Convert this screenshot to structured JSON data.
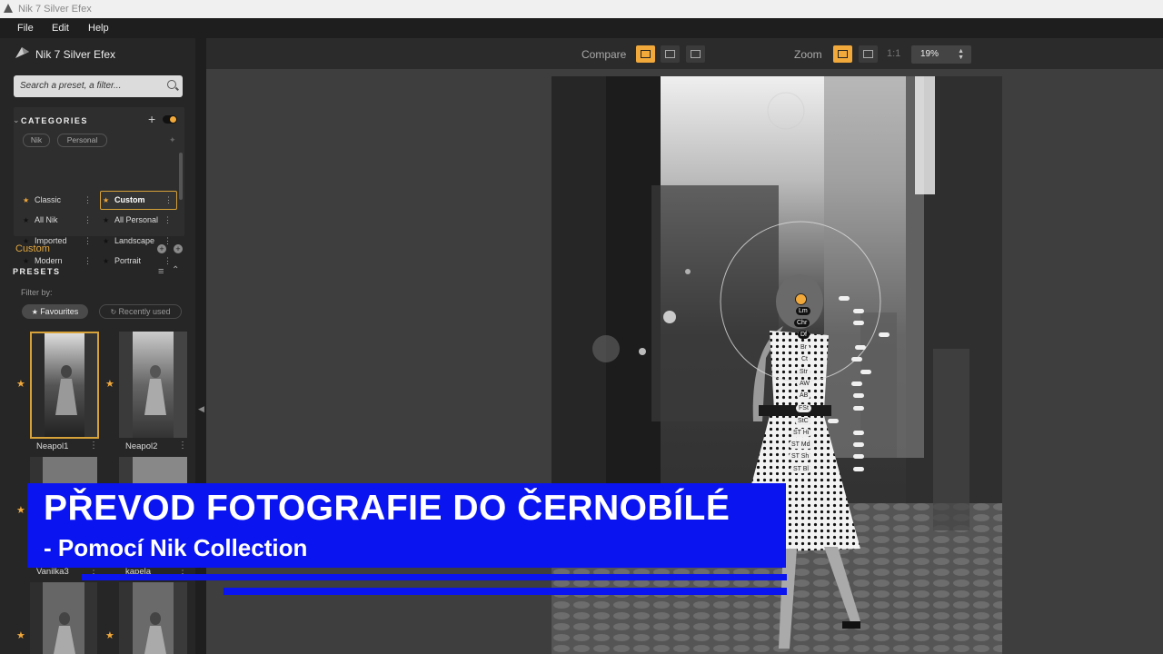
{
  "titlebar": {
    "title": "Nik 7 Silver Efex"
  },
  "menu": [
    "File",
    "Edit",
    "Help"
  ],
  "app": {
    "name": "Nik 7 Silver Efex"
  },
  "search": {
    "placeholder": "Search a preset, a filter..."
  },
  "categories": {
    "heading": "CATEGORIES",
    "pills": [
      "Nik",
      "Personal"
    ],
    "items": [
      {
        "label": "Classic",
        "starred": true
      },
      {
        "label": "Custom",
        "starred": true,
        "selected": true
      },
      {
        "label": "All Nik",
        "starred": false
      },
      {
        "label": "All Personal",
        "starred": false
      },
      {
        "label": "Imported",
        "starred": false
      },
      {
        "label": "Landscape",
        "starred": false
      },
      {
        "label": "Modern",
        "starred": false
      },
      {
        "label": "Portrait",
        "starred": false
      }
    ]
  },
  "custom_section": {
    "label": "Custom"
  },
  "presets": {
    "heading": "PRESETS",
    "filter_label": "Filter by:",
    "filters": [
      "Favourites",
      "Recently used"
    ],
    "items": [
      {
        "name": "Neapol1",
        "favourite": true,
        "selected": true
      },
      {
        "name": "Neapol2",
        "favourite": true,
        "selected": false
      },
      {
        "name": "Vanilka3",
        "favourite": true,
        "selected": false
      },
      {
        "name": "kapela",
        "favourite": true,
        "selected": false
      },
      {
        "name": "",
        "favourite": true,
        "selected": false
      },
      {
        "name": "",
        "favourite": true,
        "selected": false
      }
    ]
  },
  "toolbar": {
    "compare_label": "Compare",
    "zoom_label": "Zoom",
    "ratio_label": "1:1",
    "zoom_value": "19%"
  },
  "control_point": {
    "labels": [
      "Lm",
      "Chr",
      "Df",
      "Br",
      "Ct",
      "Str",
      "AW",
      "AB",
      "FSt",
      "StC",
      "ST Hi",
      "ST Md",
      "ST Sh",
      "ST Bl"
    ]
  },
  "banner": {
    "title": "PŘEVOD FOTOGRAFIE DO ČERNOBÍLÉ",
    "subtitle": "-  Pomocí Nik Collection"
  },
  "colors": {
    "accent": "#f2a93b",
    "banner": "#0a14f0"
  }
}
